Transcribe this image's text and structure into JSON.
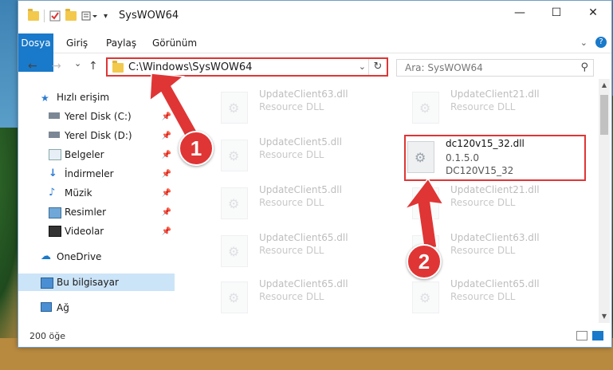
{
  "window": {
    "title": "SysWOW64",
    "controls": [
      "—",
      "☐",
      "✕"
    ]
  },
  "ribbon": {
    "tabs": [
      "Dosya",
      "Giriş",
      "Paylaş",
      "Görünüm"
    ],
    "expand_icon": "chevron-down-icon",
    "help_label": "?"
  },
  "navbar": {
    "back": "←",
    "forward": "→",
    "recent": "⌄",
    "up": "↑",
    "address": "C:\\Windows\\SysWOW64",
    "search_placeholder": "Ara: SysWOW64"
  },
  "sidebar": {
    "items": [
      {
        "label": "Hızlı erişim",
        "icon": "star-icon",
        "pinned": false
      },
      {
        "label": "Yerel Disk (C:)",
        "icon": "drive-icon",
        "pinned": true
      },
      {
        "label": "Yerel Disk (D:)",
        "icon": "drive-icon",
        "pinned": true
      },
      {
        "label": "Belgeler",
        "icon": "documents-icon",
        "pinned": true
      },
      {
        "label": "İndirmeler",
        "icon": "downloads-icon",
        "pinned": true
      },
      {
        "label": "Müzik",
        "icon": "music-icon",
        "pinned": true
      },
      {
        "label": "Resimler",
        "icon": "pictures-icon",
        "pinned": true
      },
      {
        "label": "Videolar",
        "icon": "videos-icon",
        "pinned": true
      },
      {
        "label": "OneDrive",
        "icon": "cloud-icon",
        "pinned": false
      },
      {
        "label": "Bu bilgisayar",
        "icon": "computer-icon",
        "pinned": false,
        "selected": true
      },
      {
        "label": "Ağ",
        "icon": "network-icon",
        "pinned": false
      }
    ]
  },
  "files": [
    {
      "name": "UpdateClient63.dll",
      "type": "Resource DLL"
    },
    {
      "name": "UpdateClient21.dll",
      "type": "Resource DLL"
    },
    {
      "name": "UpdateClient5.dll",
      "type": "Resource DLL"
    },
    {
      "name": "dc120v15_32.dll",
      "version": "0.1.5.0",
      "desc": "DC120V15_32"
    },
    {
      "name": "UpdateClient5.dll",
      "type": "Resource DLL"
    },
    {
      "name": "UpdateClient21.dll",
      "type": "Resource DLL"
    },
    {
      "name": "UpdateClient65.dll",
      "type": "Resource DLL"
    },
    {
      "name": "UpdateClient63.dll",
      "type": "Resource DLL"
    },
    {
      "name": "UpdateClient65.dll",
      "type": "Resource DLL"
    },
    {
      "name": "UpdateClient65.dll",
      "type": "Resource DLL"
    }
  ],
  "status": {
    "item_count": "200 öğe"
  },
  "callouts": [
    "1",
    "2"
  ],
  "colors": {
    "accent": "#1979ca",
    "highlight": "#e03535",
    "selected": "#cce4f7"
  }
}
